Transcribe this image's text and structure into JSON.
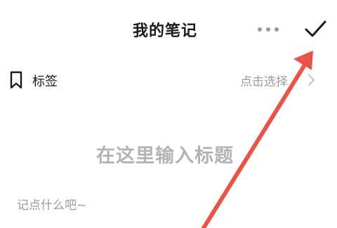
{
  "header": {
    "title": "我的笔记",
    "more_icon": "more-dots-icon",
    "done_icon": "checkmark-icon"
  },
  "tag_row": {
    "label": "标签",
    "icon": "bookmark-icon",
    "action_text": "点击选择",
    "chevron_icon": "chevron-right-icon"
  },
  "editor": {
    "title_placeholder": "在这里输入标题",
    "body_placeholder": "记点什么吧~"
  },
  "annotation": {
    "arrow_color": "#e8534a",
    "points_to": "done-button"
  }
}
